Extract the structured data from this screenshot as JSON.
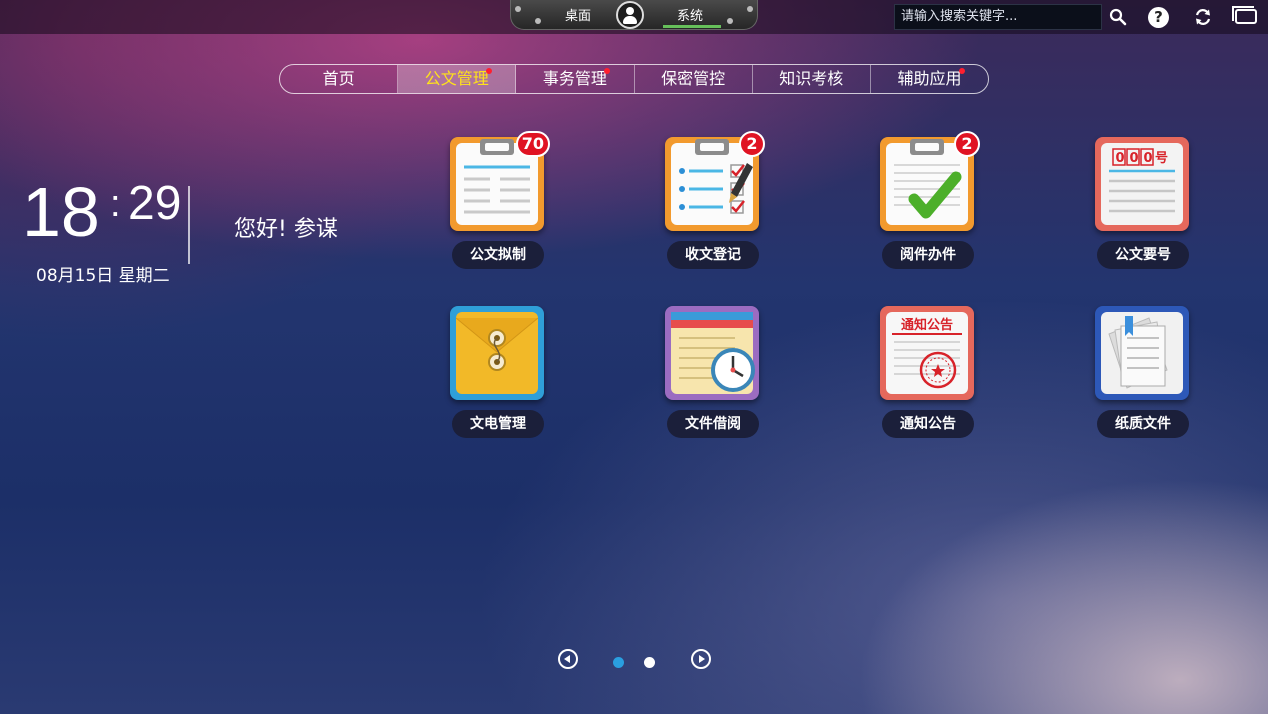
{
  "topbar": {
    "dock_tabs": [
      "桌面",
      "系统"
    ],
    "search_placeholder": "请输入搜索关键字..."
  },
  "nav": {
    "items": [
      {
        "label": "首页",
        "active": false,
        "dot": false
      },
      {
        "label": "公文管理",
        "active": true,
        "dot": true
      },
      {
        "label": "事务管理",
        "active": false,
        "dot": true
      },
      {
        "label": "保密管控",
        "active": false,
        "dot": false
      },
      {
        "label": "知识考核",
        "active": false,
        "dot": false
      },
      {
        "label": "辅助应用",
        "active": false,
        "dot": true
      }
    ]
  },
  "clock": {
    "hour": "18",
    "minute": "29",
    "date": "08月15日 星期二"
  },
  "greeting": "您好! 参谋",
  "apps": [
    {
      "label": "公文拟制",
      "badge": "70",
      "icon": "document-drafting-icon"
    },
    {
      "label": "收文登记",
      "badge": "2",
      "icon": "receipt-register-icon"
    },
    {
      "label": "阅件办件",
      "badge": "2",
      "icon": "review-check-icon"
    },
    {
      "label": "公文要号",
      "badge": "",
      "icon": "document-number-icon",
      "icon_text": "000号"
    },
    {
      "label": "文电管理",
      "badge": "",
      "icon": "envelope-icon"
    },
    {
      "label": "文件借阅",
      "badge": "",
      "icon": "file-borrow-clock-icon"
    },
    {
      "label": "通知公告",
      "badge": "",
      "icon": "notice-stamp-icon",
      "icon_text": "通知公告"
    },
    {
      "label": "纸质文件",
      "badge": "",
      "icon": "paper-files-icon"
    }
  ],
  "pager": {
    "pages": 2,
    "current": 1
  },
  "colors": {
    "accent_active": "#ffe21a",
    "badge": "#e01323",
    "dock_underline": "#66c05a",
    "pager_active": "#2a9fe0"
  }
}
